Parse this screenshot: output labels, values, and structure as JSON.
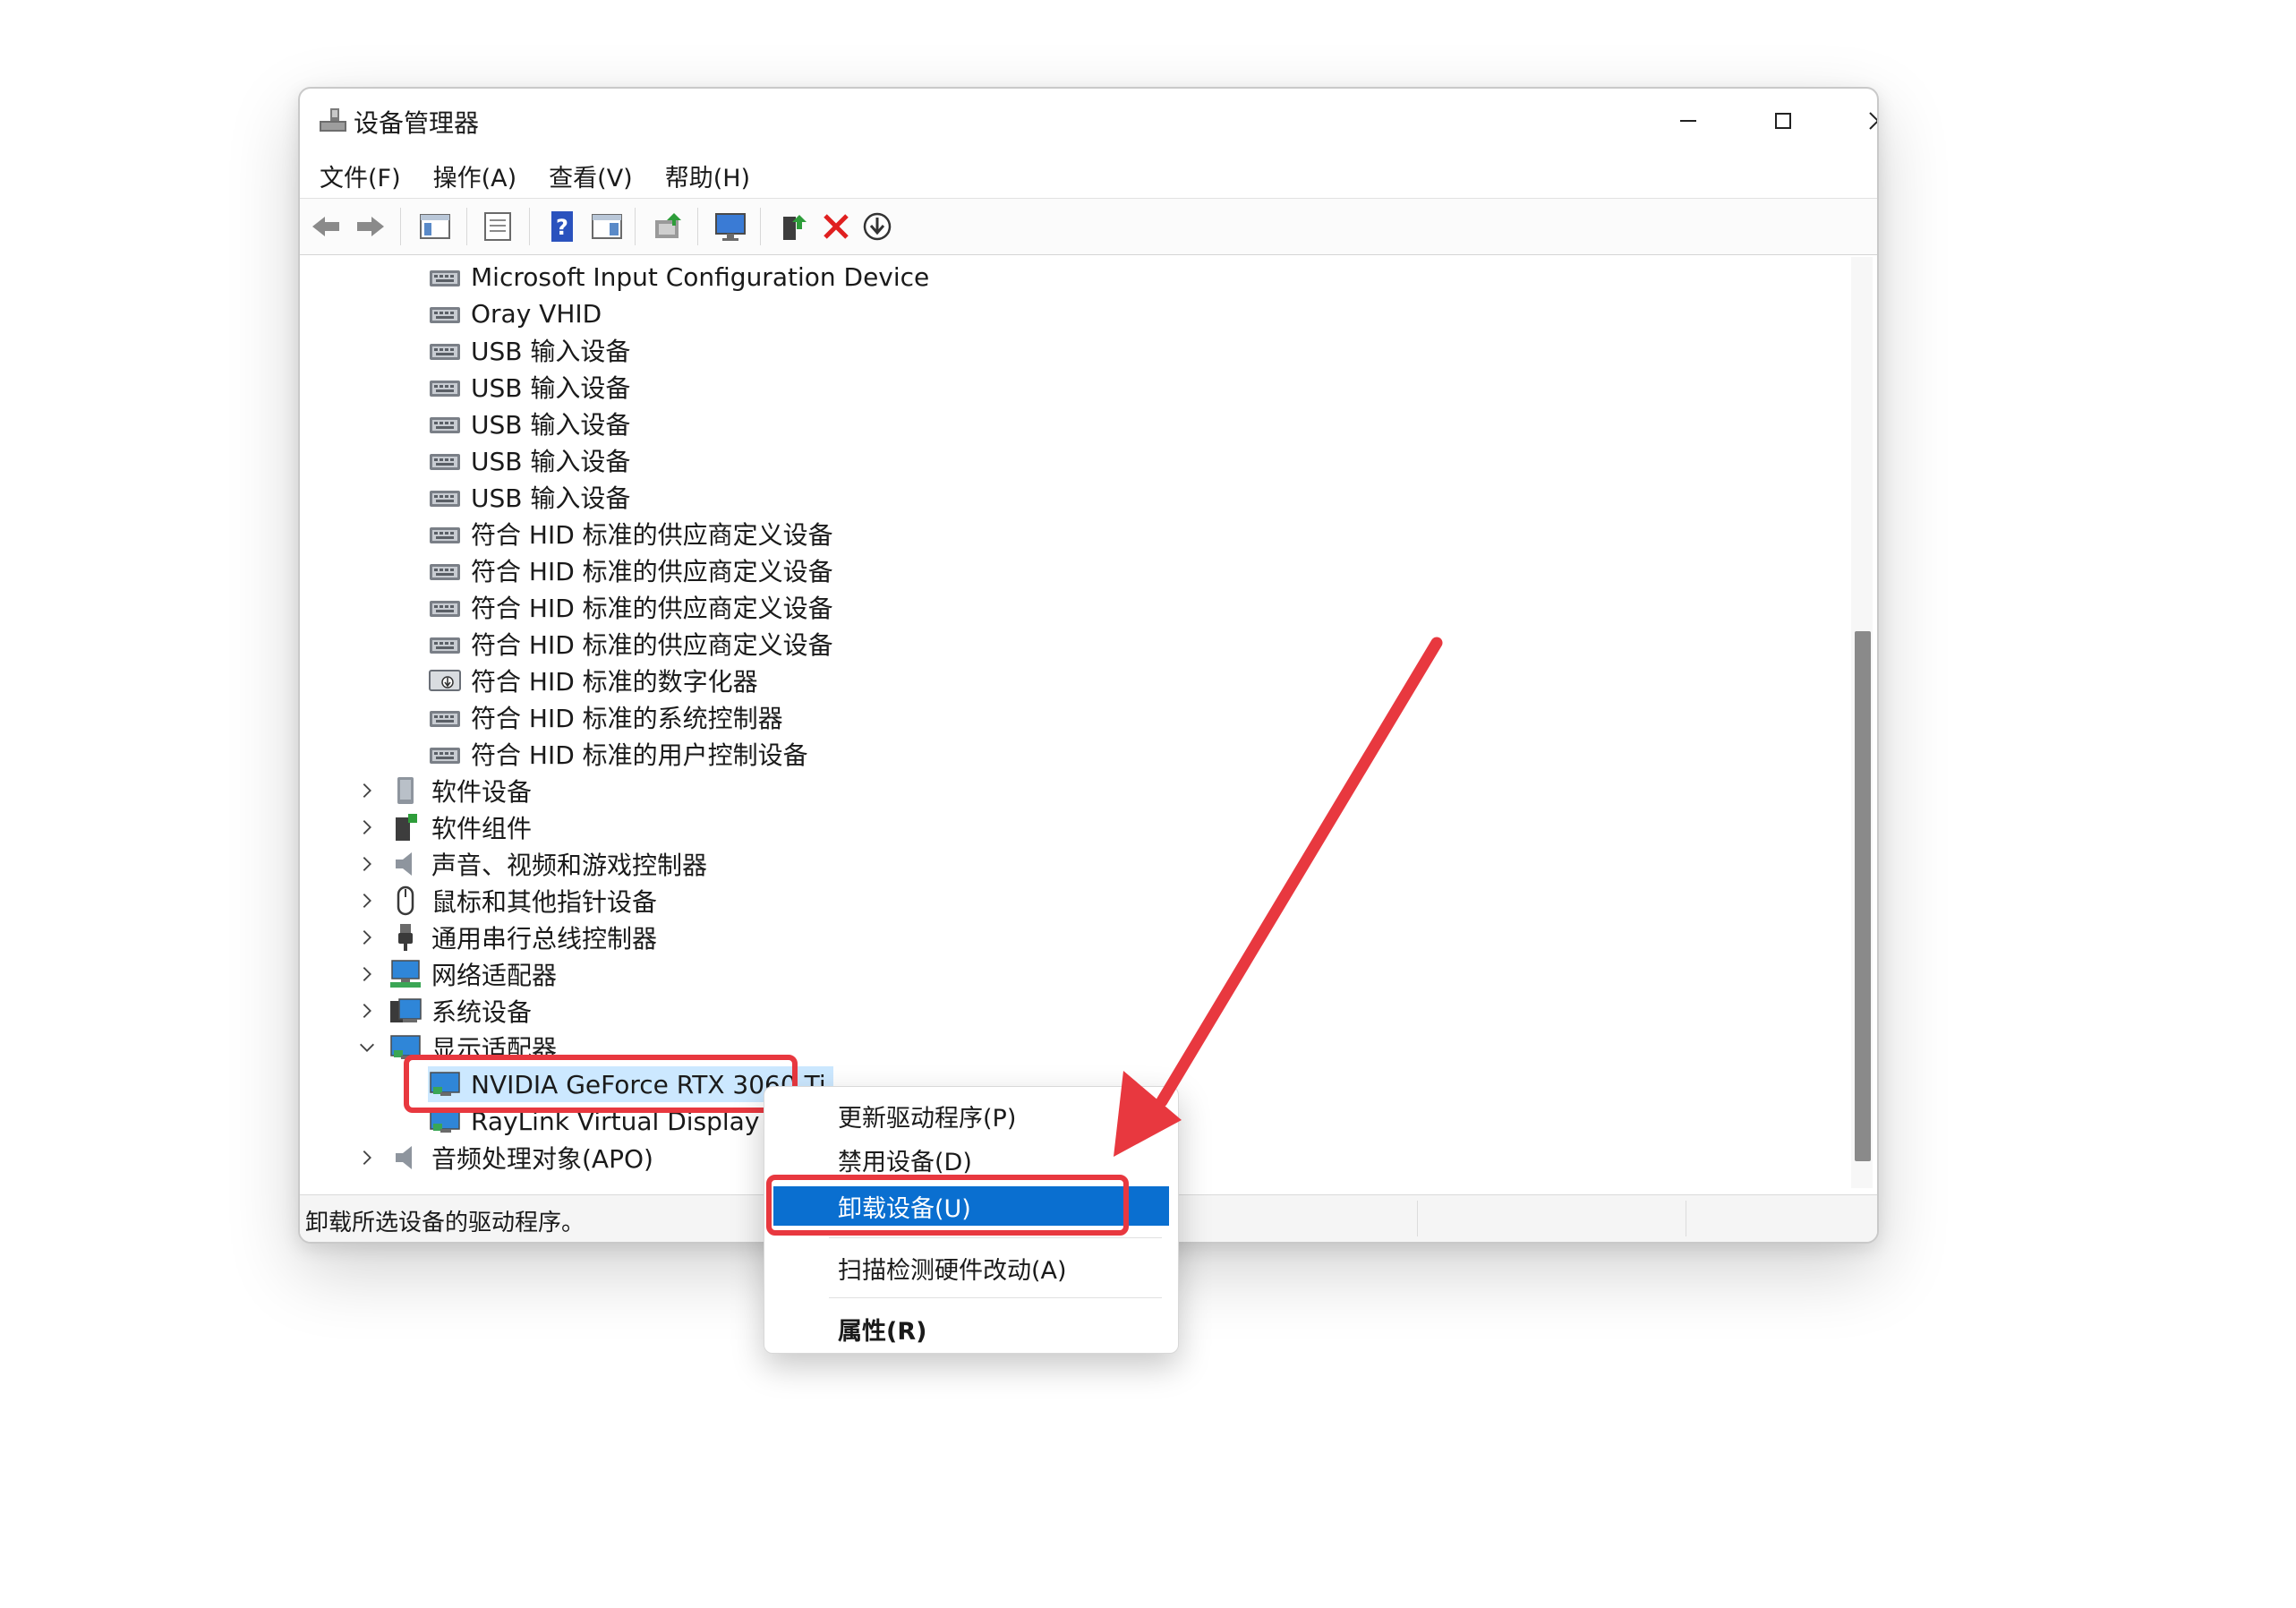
{
  "window": {
    "title": "设备管理器"
  },
  "menu": [
    "文件(F)",
    "操作(A)",
    "查看(V)",
    "帮助(H)"
  ],
  "tree": {
    "hid_children": [
      "Microsoft Input Configuration Device",
      "Oray VHID",
      "USB 输入设备",
      "USB 输入设备",
      "USB 输入设备",
      "USB 输入设备",
      "USB 输入设备",
      "符合 HID 标准的供应商定义设备",
      "符合 HID 标准的供应商定义设备",
      "符合 HID 标准的供应商定义设备",
      "符合 HID 标准的供应商定义设备",
      "符合 HID 标准的数字化器",
      "符合 HID 标准的系统控制器",
      "符合 HID 标准的用户控制设备"
    ],
    "categories_before": [
      {
        "label": "软件设备",
        "icon": "software-device-icon"
      },
      {
        "label": "软件组件",
        "icon": "software-component-icon"
      },
      {
        "label": "声音、视频和游戏控制器",
        "icon": "speaker-icon"
      },
      {
        "label": "鼠标和其他指针设备",
        "icon": "mouse-icon"
      },
      {
        "label": "通用串行总线控制器",
        "icon": "usb-icon"
      },
      {
        "label": "网络适配器",
        "icon": "network-adapter-icon"
      },
      {
        "label": "系统设备",
        "icon": "system-device-icon"
      }
    ],
    "display_adapters": {
      "label": "显示适配器",
      "children": [
        "NVIDIA GeForce RTX 3060 Ti",
        "RayLink Virtual Display Ada"
      ]
    },
    "last_category": "音频处理对象(APO)"
  },
  "status": "卸载所选设备的驱动程序。",
  "context_menu": {
    "items": [
      "更新驱动程序(P)",
      "禁用设备(D)",
      "卸载设备(U)",
      "扫描检测硬件改动(A)",
      "属性(R)"
    ],
    "highlighted_index": 2
  },
  "colors": {
    "highlight": "#0a6fd0",
    "annotation_red": "#e8383f",
    "selection": "#cce8ff"
  }
}
